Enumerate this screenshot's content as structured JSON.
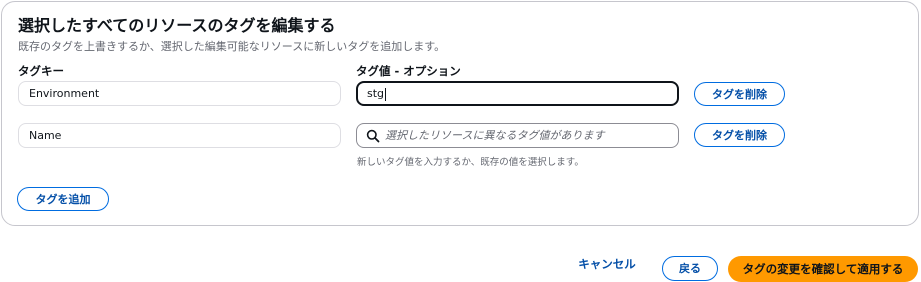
{
  "panel": {
    "title": "選択したすべてのリソースのタグを編集する",
    "description": "既存のタグを上書きするか、選択した編集可能なリソースに新しいタグを追加します。"
  },
  "columns": {
    "key_label": "タグキー",
    "value_label": "タグ値 - オプション"
  },
  "rows": [
    {
      "key": "Environment",
      "value": "stg",
      "value_placeholder": "",
      "remove_label": "タグを削除"
    },
    {
      "key": "Name",
      "value": "",
      "value_placeholder": "選択したリソースに異なるタグ値があります",
      "remove_label": "タグを削除"
    }
  ],
  "value_hint": "新しいタグ値を入力するか、既存の値を選択します。",
  "add_tag_label": "タグを追加",
  "footer": {
    "cancel_label": "キャンセル",
    "back_label": "戻る",
    "confirm_label": "タグの変更を確認して適用する"
  },
  "colors": {
    "primary_button": "#ff9900",
    "link_blue": "#0550a8",
    "button_border": "#006ce0"
  },
  "icons": {
    "search": "search-icon"
  }
}
